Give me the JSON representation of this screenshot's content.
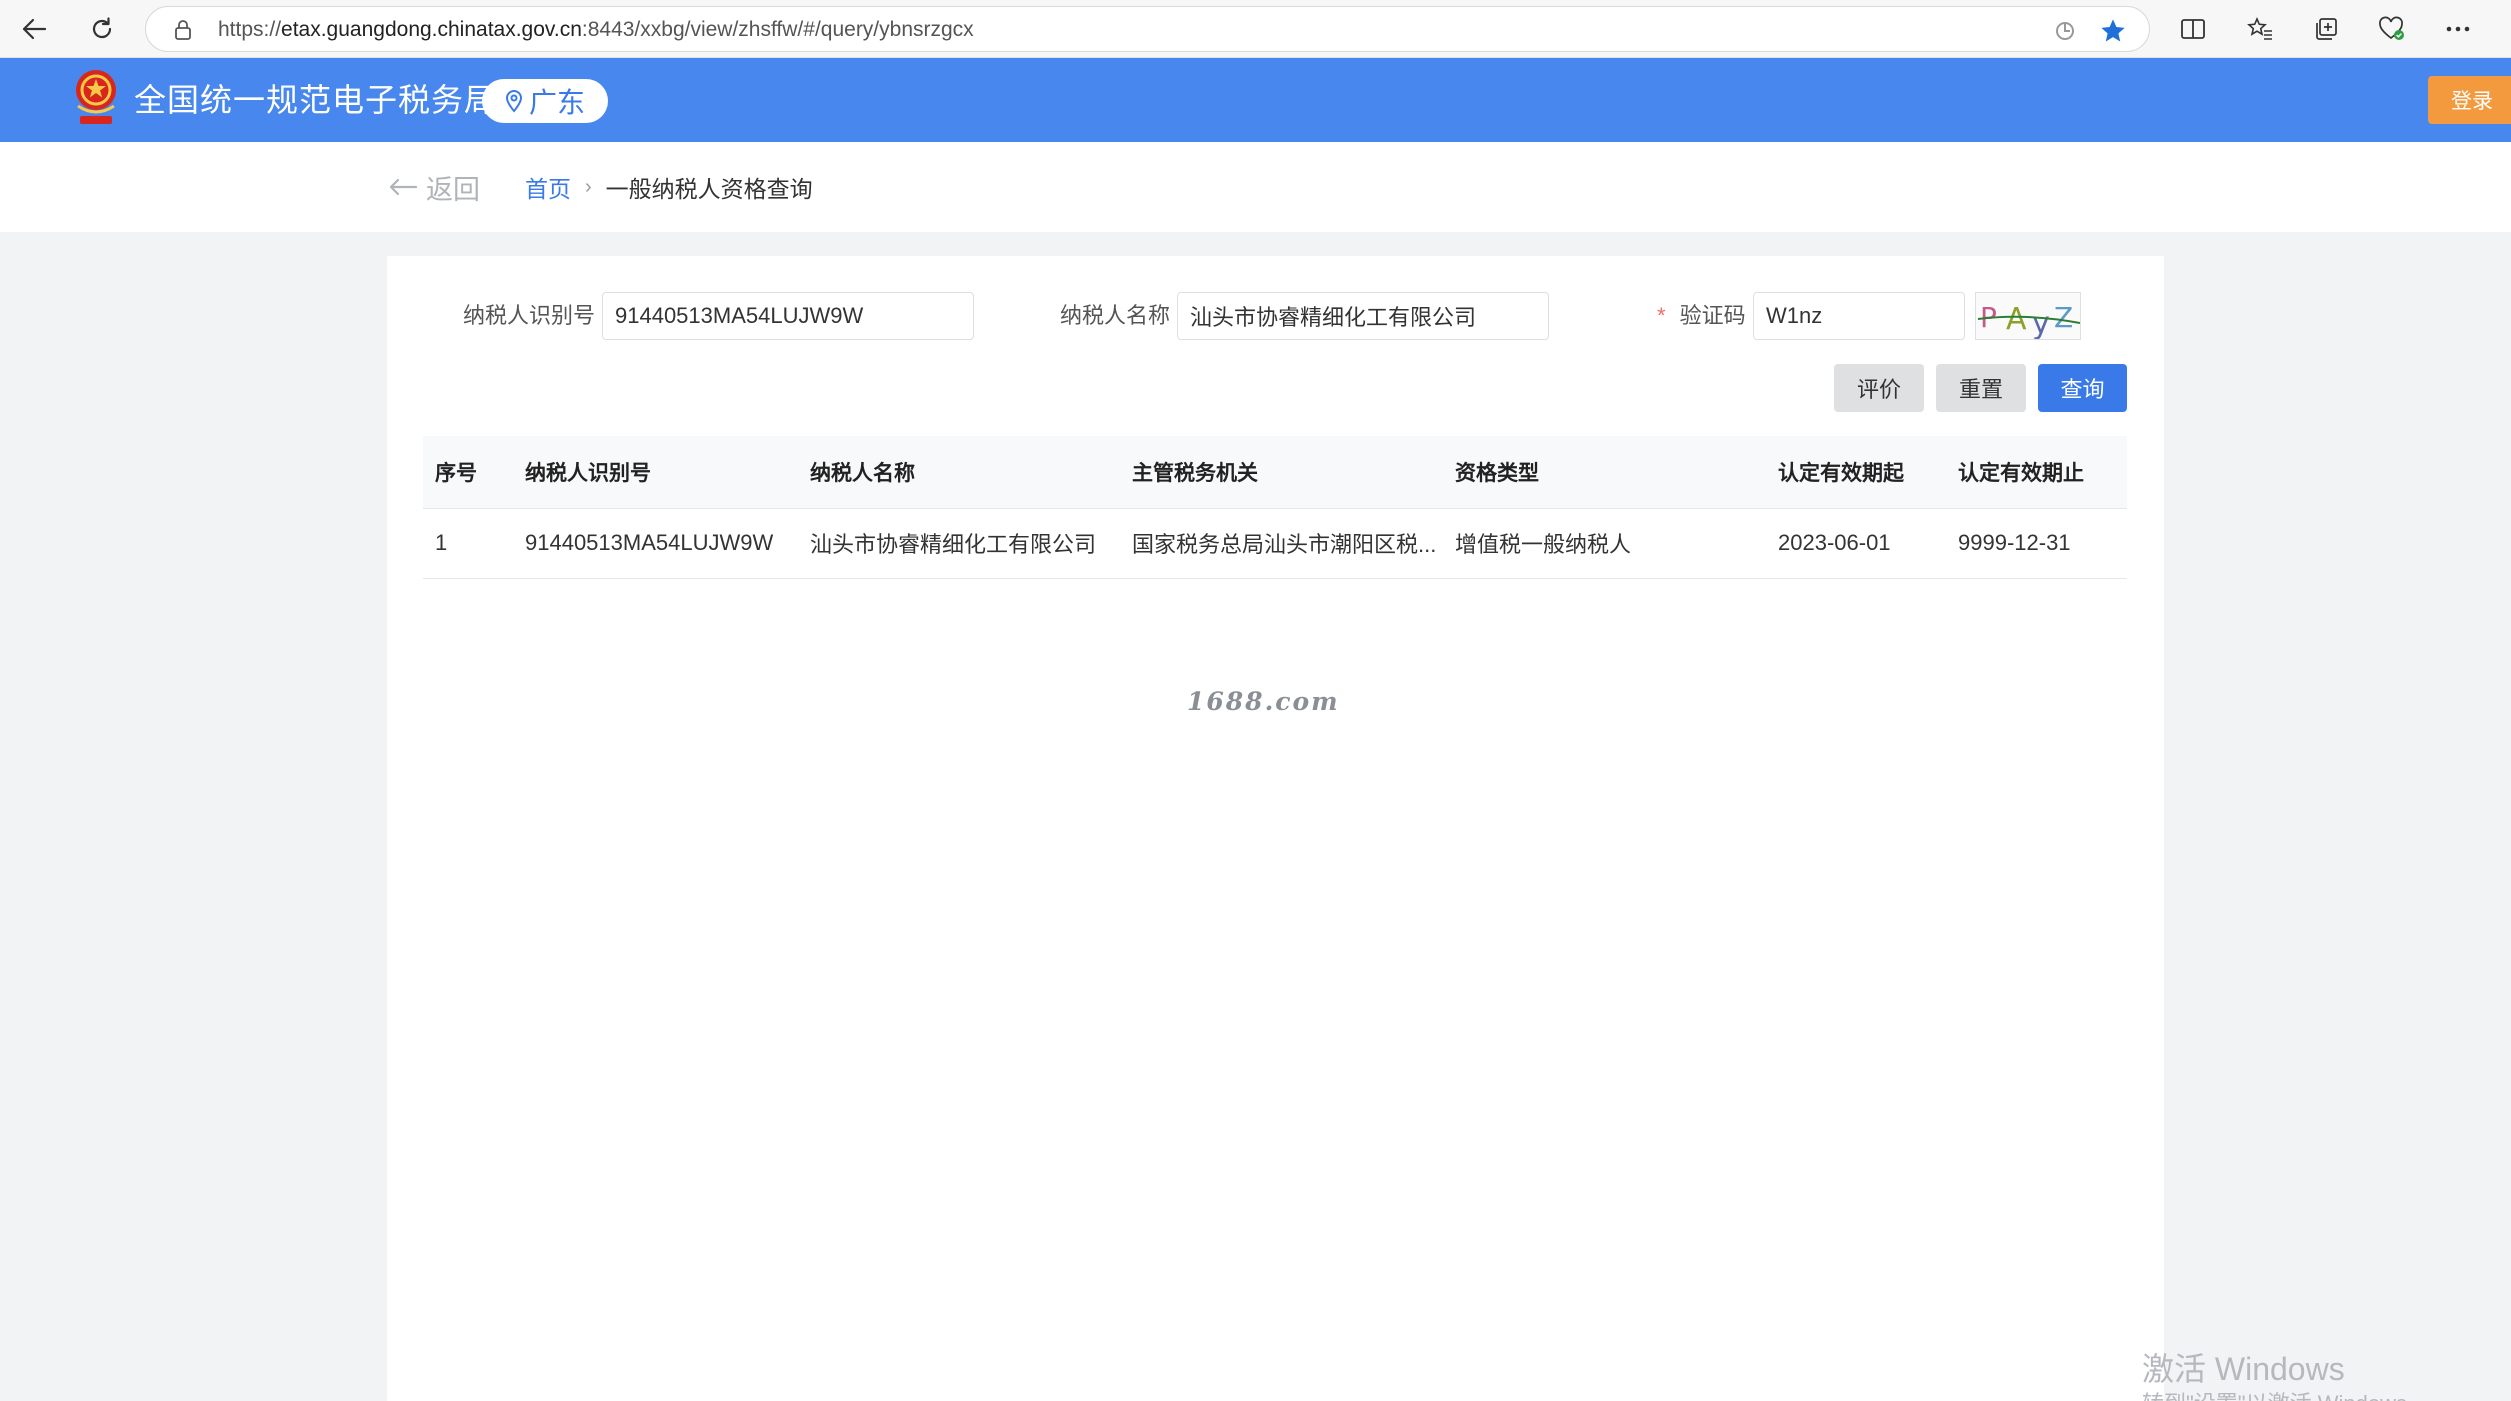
{
  "browser": {
    "url_prefix": "https://",
    "url_host": "etax.guangdong.chinatax.gov.cn",
    "url_rest": ":8443/xxbg/view/zhsffw/#/query/ybnsrzgcx"
  },
  "header": {
    "site_title": "全国统一规范电子税务局",
    "region": "广东",
    "login_label": "登录"
  },
  "breadcrumb": {
    "back_label": "返回",
    "home_label": "首页",
    "separator": "›",
    "current_label": "一般纳税人资格查询"
  },
  "form": {
    "taxpayer_id_label": "纳税人识别号",
    "taxpayer_id_value": "91440513MA54LUJW9W",
    "taxpayer_name_label": "纳税人名称",
    "taxpayer_name_value": "汕头市协睿精细化工有限公司",
    "captcha_required_mark": "*",
    "captcha_label": "验证码",
    "captcha_value": "W1nz",
    "captcha_image_text": [
      "P",
      "A",
      "y",
      "Z"
    ],
    "evaluate_label": "评价",
    "reset_label": "重置",
    "query_label": "查询"
  },
  "table": {
    "columns": [
      "序号",
      "纳税人识别号",
      "纳税人名称",
      "主管税务机关",
      "资格类型",
      "认定有效期起",
      "认定有效期止"
    ],
    "rows": [
      [
        "1",
        "91440513MA54LUJW9W",
        "汕头市协睿精细化工有限公司",
        "国家税务总局汕头市潮阳区税...",
        "增值税一般纳税人",
        "2023-06-01",
        "9999-12-31"
      ]
    ]
  },
  "watermark": "1688.com",
  "os_notice": {
    "title": "激活 Windows",
    "subtitle": "转到\"设置\"以激活 Windows。"
  },
  "colors": {
    "header_blue": "#4787ee",
    "primary_blue": "#3a7ae8",
    "login_orange": "#f29a3d",
    "required_red": "#f56c6c"
  },
  "icons": [
    "back-arrow-icon",
    "reload-icon",
    "lock-icon",
    "translate-icon",
    "star-icon",
    "split-screen-icon",
    "favorites-icon",
    "collections-icon",
    "health-icon",
    "more-icon",
    "national-emblem-icon",
    "location-pin-icon",
    "back-icon"
  ]
}
